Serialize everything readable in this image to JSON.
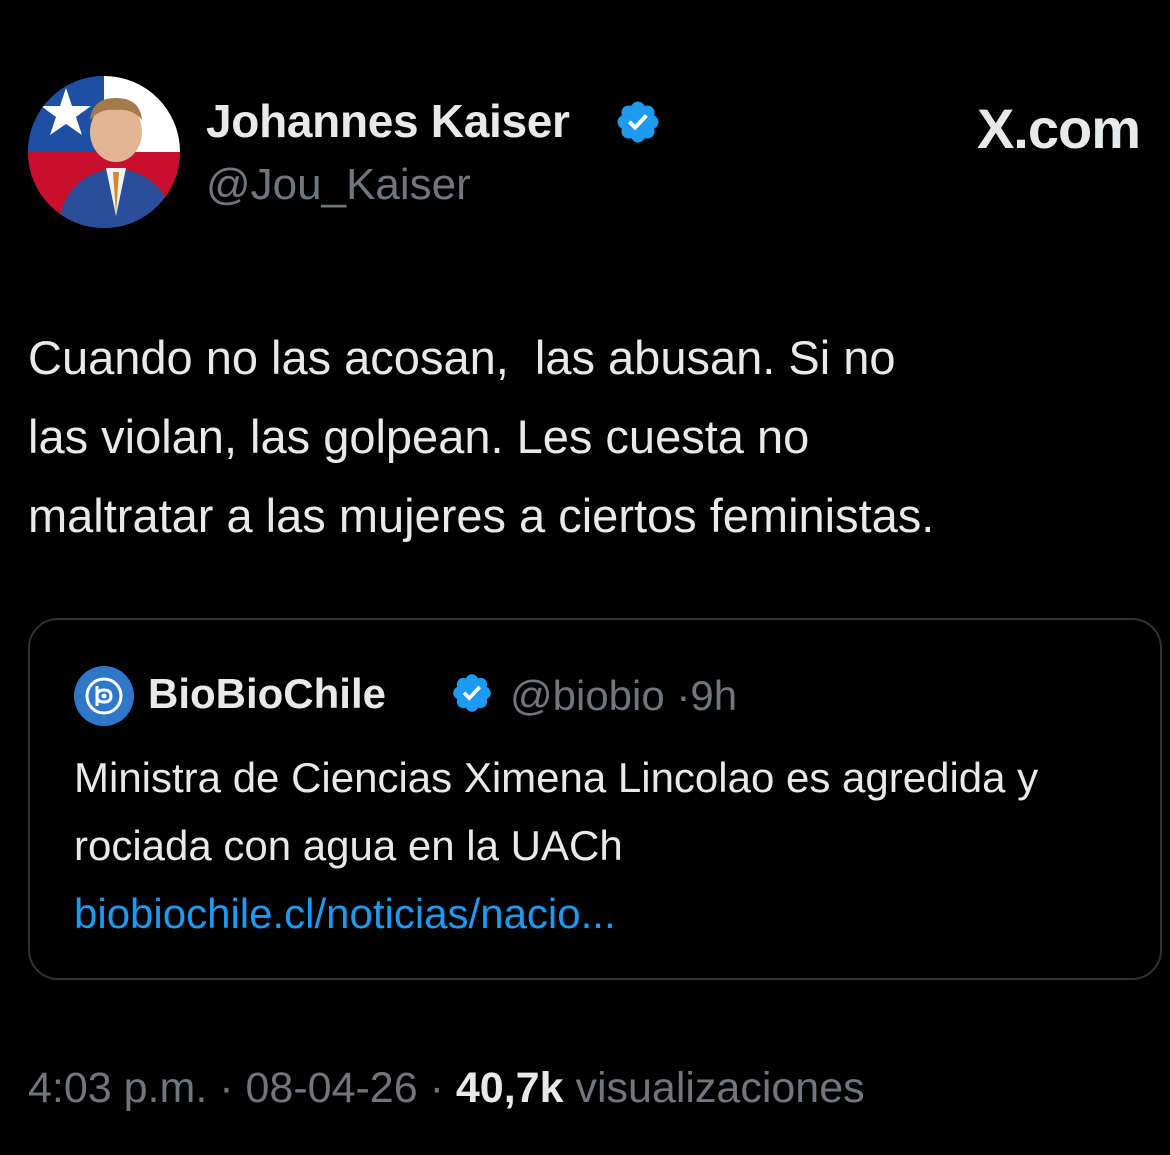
{
  "author": {
    "name": "Johannes Kaiser",
    "handle": "@Jou_Kaiser"
  },
  "brand": "X.com",
  "tweet": {
    "text": "Cuando no las acosan,  las abusan. Si no\nlas violan, las golpean. Les cuesta no\nmaltratar a las mujeres a ciertos feministas."
  },
  "quote": {
    "name": "BioBioChile",
    "handle": "@biobio",
    "separator": "·",
    "time": "9h",
    "text": "Ministra de Ciencias Ximena Lincolao es agredida y rociada con agua en la UACh",
    "link": "biobiochile.cl/noticias/nacio..."
  },
  "footer": {
    "time": "4:03 p.m.",
    "date": "08-04-26",
    "separator": "·",
    "views_count": "40,7k",
    "views_label": "visualizaciones"
  },
  "colors": {
    "background": "#000000",
    "text": "#e7e9ea",
    "muted": "#71767b",
    "link": "#1d9bf0",
    "verified": "#1d9bf0",
    "border": "#2f3336",
    "biobio_blue": "#2f77c9"
  },
  "icons": {
    "verified": "verified-badge-icon",
    "biobio_logo": "biobio-logo-icon",
    "avatar": "profile-photo"
  }
}
